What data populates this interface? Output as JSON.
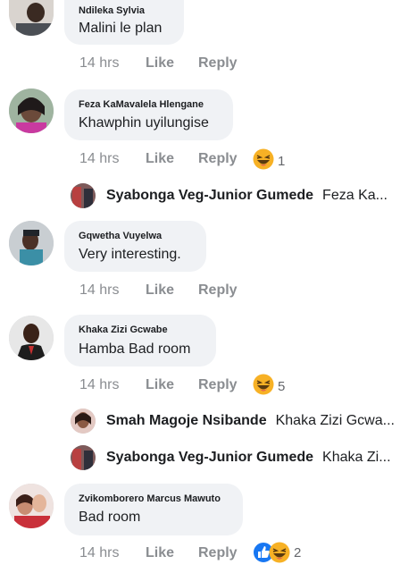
{
  "comments": [
    {
      "author": "Ndileka Sylvia",
      "text": "Malini le plan",
      "time": "14 hrs",
      "like_label": "Like",
      "reply_label": "Reply"
    },
    {
      "author": "Feza KaMavalela Hlengane",
      "text": "Khawphin uyilungise",
      "time": "14 hrs",
      "like_label": "Like",
      "reply_label": "Reply",
      "reaction": {
        "icons": [
          "haha-icon"
        ],
        "count": "1"
      },
      "replies": [
        {
          "author": "Syabonga Veg-Junior Gumede",
          "preview": "Feza Ka..."
        }
      ]
    },
    {
      "author": "Gqwetha Vuyelwa",
      "text": "Very interesting.",
      "time": "14 hrs",
      "like_label": "Like",
      "reply_label": "Reply"
    },
    {
      "author": "Khaka Zizi Gcwabe",
      "text": "Hamba Bad room",
      "time": "14 hrs",
      "like_label": "Like",
      "reply_label": "Reply",
      "reaction": {
        "icons": [
          "haha-icon"
        ],
        "count": "5"
      },
      "replies": [
        {
          "author": "Smah Magoje Nsibande",
          "preview": "Khaka Zizi Gcwa..."
        },
        {
          "author": "Syabonga Veg-Junior Gumede",
          "preview": "Khaka Zi..."
        }
      ]
    },
    {
      "author": "Zvikomborero Marcus Mawuto",
      "text": "Bad room",
      "time": "14 hrs",
      "like_label": "Like",
      "reply_label": "Reply",
      "reaction": {
        "icons": [
          "like-icon",
          "haha-icon"
        ],
        "count": "2"
      }
    }
  ],
  "colors": {
    "bubble": "#f0f2f5",
    "meta_text": "#8a8d91",
    "like_blue": "#1877f2",
    "haha_yellow": "#f7b125"
  }
}
